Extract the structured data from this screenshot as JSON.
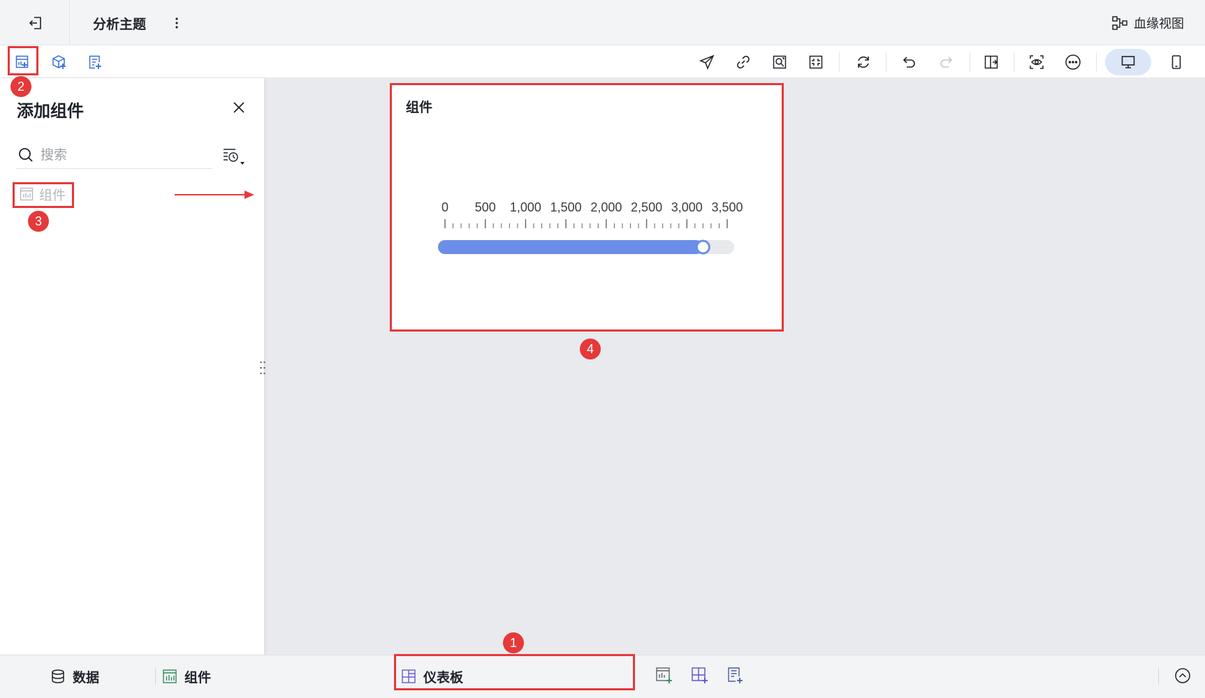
{
  "header": {
    "title": "分析主题",
    "lineage_label": "血缘视图",
    "exit_icon": "exit-icon",
    "more_icon": "more-vertical-icon",
    "lineage_icon": "lineage-icon"
  },
  "toolbar": {
    "left_icons": [
      "add-component-icon",
      "add-dataset-icon",
      "add-report-icon"
    ],
    "right_icons": [
      "send-icon",
      "link-icon",
      "screenshot-icon",
      "fit-icon",
      "refresh-icon",
      "undo-icon",
      "redo-icon",
      "export-icon",
      "preview-icon",
      "more-icon"
    ],
    "device_active": "desktop-icon",
    "device_other": "mobile-icon"
  },
  "panel": {
    "title": "添加组件",
    "search_placeholder": "搜索",
    "items": [
      {
        "label": "组件",
        "icon": "chart-table-icon"
      }
    ]
  },
  "card": {
    "title": "组件",
    "slider": {
      "min": 0,
      "max": 3500,
      "value": 3200,
      "tick_labels": [
        "0",
        "500",
        "1,000",
        "1,500",
        "2,000",
        "2,500",
        "3,000",
        "3,500"
      ],
      "fill_color": "#6b8fe8",
      "track_color": "#e8e9ec"
    }
  },
  "bottom": {
    "data_tab": "数据",
    "component_tab": "组件",
    "dashboard_tab": "仪表板",
    "add_icons": [
      "add-chart-icon",
      "add-dashboard-icon",
      "add-report-page-icon"
    ],
    "collapse_icon": "chevron-up-icon"
  },
  "annotations": {
    "color": "#e5393a",
    "badges": [
      "1",
      "2",
      "3",
      "4"
    ]
  }
}
